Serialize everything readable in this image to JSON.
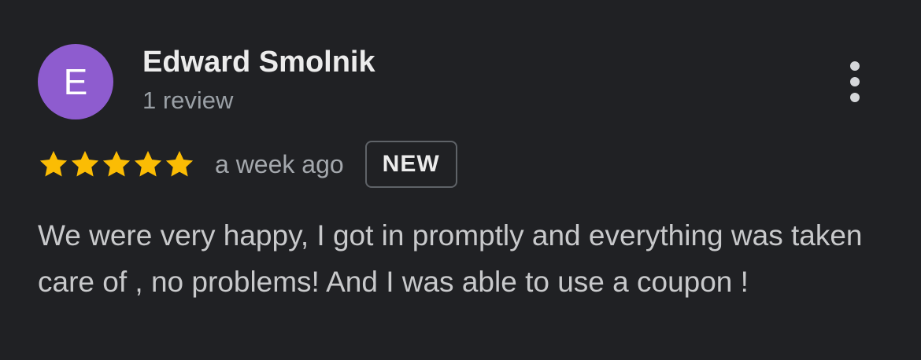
{
  "review": {
    "author": {
      "initial": "E",
      "name": "Edward Smolnik",
      "review_count": "1 review",
      "avatar_color": "#8e5ccf"
    },
    "menu_icon": "more-vert-icon",
    "rating": {
      "stars": 5,
      "max_stars": 5,
      "star_color": "#fbbc04",
      "star_icon": "star-icon"
    },
    "date": "a week ago",
    "badge": "NEW",
    "text": "We were very happy, I got in promptly and everything was taken care of , no problems! And I was able to use a coupon !"
  }
}
